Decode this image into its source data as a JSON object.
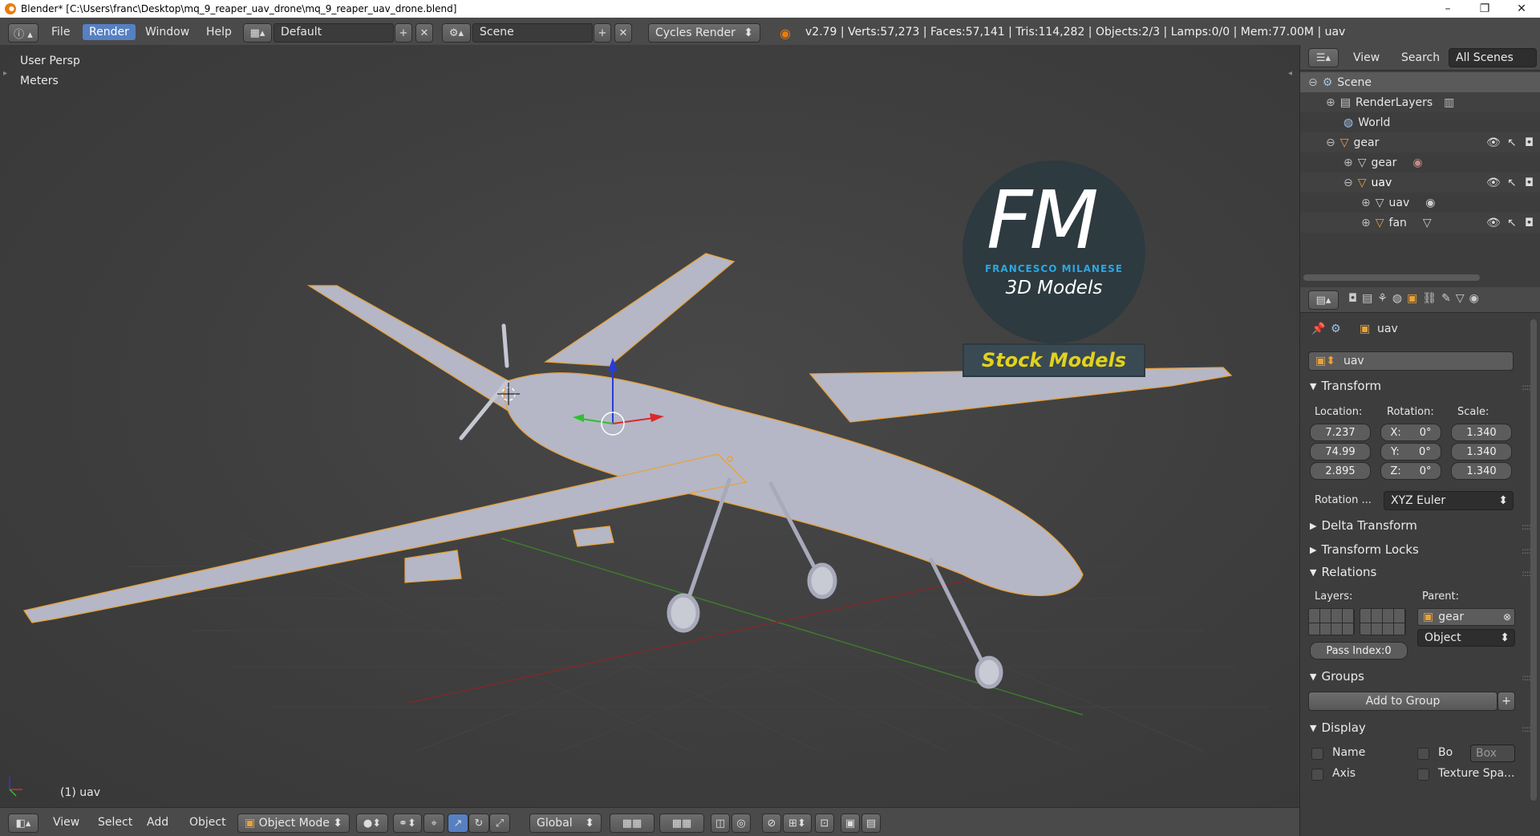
{
  "titlebar": {
    "title": "Blender* [C:\\Users\\franc\\Desktop\\mq_9_reaper_uav_drone\\mq_9_reaper_uav_drone.blend]",
    "minimize": "–",
    "restore": "❐",
    "close": "✕"
  },
  "header": {
    "menus": [
      "File",
      "Render",
      "Window",
      "Help"
    ],
    "layout": "Default",
    "scene": "Scene",
    "engine": "Cycles Render",
    "stats": "v2.79 | Verts:57,273 | Faces:57,141 | Tris:114,282 | Objects:2/3 | Lamps:0/0 | Mem:77.00M | uav"
  },
  "viewport": {
    "view_name": "User Persp",
    "units": "Meters",
    "object_label": "(1) uav",
    "watermark": {
      "logo": "FM",
      "author": "FRANCESCO MILANESE",
      "subtitle": "3D Models",
      "banner": "Stock Models"
    }
  },
  "bottombar": {
    "menus": [
      "View",
      "Select",
      "Add",
      "Object"
    ],
    "mode": "Object Mode",
    "orientation": "Global"
  },
  "outliner": {
    "tabs": [
      "View",
      "Search",
      "All Scenes"
    ],
    "rows": [
      {
        "label": "Scene"
      },
      {
        "label": "RenderLayers"
      },
      {
        "label": "World"
      },
      {
        "label": "gear"
      },
      {
        "label": "gear"
      },
      {
        "label": "uav"
      },
      {
        "label": "uav"
      },
      {
        "label": "fan"
      }
    ]
  },
  "properties": {
    "breadcrumb": "uav",
    "object_name": "uav",
    "transform": {
      "title": "Transform",
      "location_label": "Location:",
      "rotation_label": "Rotation:",
      "scale_label": "Scale:",
      "location": [
        "7.237",
        "74.99",
        "2.895"
      ],
      "rotation": [
        "X:",
        "0°",
        "Y:",
        "0°",
        "Z:",
        "0°"
      ],
      "scale": [
        "1.340",
        "1.340",
        "1.340"
      ],
      "rotation_mode_label": "Rotation ...",
      "rotation_mode": "XYZ Euler"
    },
    "delta_transform": "Delta Transform",
    "transform_locks": "Transform Locks",
    "relations": {
      "title": "Relations",
      "layers_label": "Layers:",
      "parent_label": "Parent:",
      "parent": "gear",
      "parent_type": "Object",
      "pass_index": "Pass Index:0"
    },
    "groups": {
      "title": "Groups",
      "add_button": "Add to Group"
    },
    "display": {
      "title": "Display",
      "name": "Name",
      "bo": "Bo",
      "box": "Box",
      "axis": "Axis",
      "texture_space": "Texture Spa..."
    }
  },
  "colors": {
    "accent_blue": "#5680c2",
    "selection_orange": "#e8a23a",
    "fm_blue": "#2ca7df",
    "stock_yellow": "#e2d21c"
  }
}
